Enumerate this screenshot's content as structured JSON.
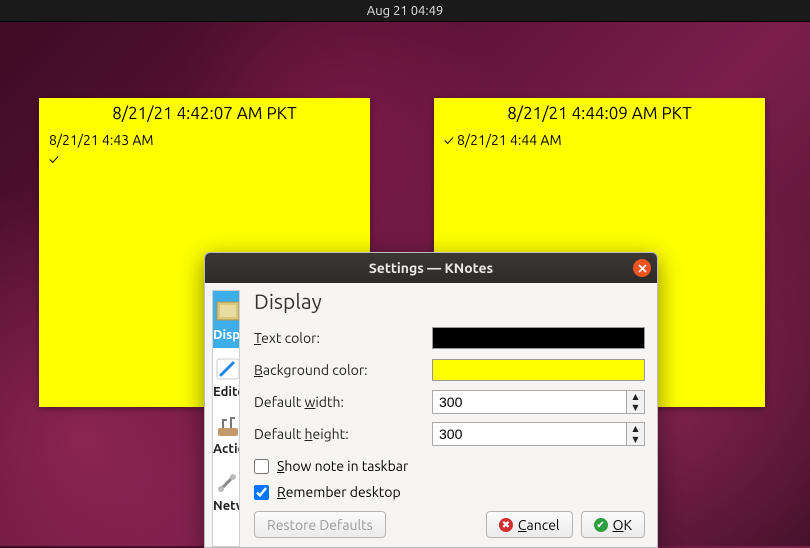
{
  "topbar": {
    "clock": "Aug 21  04:49"
  },
  "notes": [
    {
      "title": "8/21/21 4:42:07 AM PKT",
      "line1": "8/21/21 4:43 AM",
      "line2": "✓"
    },
    {
      "title": "8/21/21 4:44:09 AM PKT",
      "line1": "✓ 8/21/21 4:44 AM"
    }
  ],
  "dialog": {
    "title": "Settings — KNotes",
    "categories": {
      "display": "Display",
      "editor": "Editor",
      "actions": "Actions",
      "network": "Network"
    },
    "heading": "Display",
    "labels": {
      "text_color": "Text color:",
      "bg_color": "Background color:",
      "def_width": "Default width:",
      "def_height": "Default height:",
      "show_taskbar": "Show note in taskbar",
      "remember_desktop": "Remember desktop"
    },
    "values": {
      "text_color": "#000000",
      "bg_color": "#ffff00",
      "def_width": "300",
      "def_height": "300",
      "show_taskbar": false,
      "remember_desktop": true
    },
    "buttons": {
      "restore": "Restore Defaults",
      "cancel": "Cancel",
      "ok": "OK"
    }
  }
}
